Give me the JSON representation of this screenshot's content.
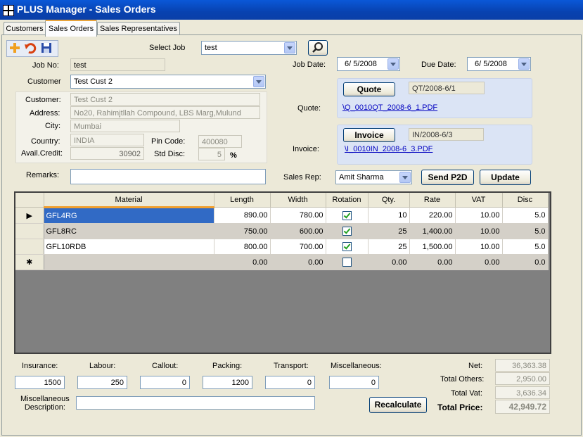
{
  "window": {
    "title": "PLUS Manager - Sales Orders"
  },
  "tabs": [
    {
      "label": "Customers"
    },
    {
      "label": "Sales Orders"
    },
    {
      "label": "Sales Representatives"
    }
  ],
  "toolbar": {
    "add_icon": "add-icon",
    "undo_icon": "undo-icon",
    "save_icon": "save-icon"
  },
  "select_job": {
    "label": "Select Job",
    "value": "test",
    "search_icon": "search-icon"
  },
  "job": {
    "job_no_label": "Job No:",
    "job_no": "test",
    "job_date_label": "Job Date:",
    "job_date": "6/ 5/2008",
    "due_date_label": "Due Date:",
    "due_date": "6/ 5/2008"
  },
  "customer": {
    "label": "Customer",
    "value": "Test Cust 2",
    "name_label": "Customer:",
    "name": "Test Cust 2",
    "address_label": "Address:",
    "address": "No20, Rahimjtllah Compound, LBS Marg,Mulund",
    "city_label": "City:",
    "city": "Mumbai",
    "country_label": "Country:",
    "country": "INDIA",
    "pin_label": "Pin Code:",
    "pin": "400080",
    "credit_label": "Avail.Credit:",
    "credit": "30902",
    "disc_label": "Std Disc:",
    "disc": "5",
    "disc_unit": "%"
  },
  "quote": {
    "button": "Quote",
    "number": "QT/2008-6/1",
    "label": "Quote:",
    "link": "\\Q_0010QT_2008-6_1.PDF"
  },
  "invoice": {
    "button": "Invoice",
    "number": "IN/2008-6/3",
    "label": "Invoice:",
    "link": "\\I_0010IN_2008-6_3.PDF"
  },
  "remarks": {
    "label": "Remarks:",
    "value": ""
  },
  "sales_rep": {
    "label": "Sales Rep:",
    "value": "Amit Sharma"
  },
  "buttons": {
    "send_p2d": "Send P2D",
    "update": "Update",
    "recalculate": "Recalculate"
  },
  "grid": {
    "columns": [
      "Material",
      "Length",
      "Width",
      "Rotation",
      "Qty.",
      "Rate",
      "VAT",
      "Disc"
    ],
    "rows": [
      {
        "marker": "▶",
        "material": "GFL4RG",
        "length": "890.00",
        "width": "780.00",
        "rotation": true,
        "qty": "10",
        "rate": "220.00",
        "vat": "10.00",
        "disc": "5.0"
      },
      {
        "marker": "",
        "material": "GFL8RC",
        "length": "750.00",
        "width": "600.00",
        "rotation": true,
        "qty": "25",
        "rate": "1,400.00",
        "vat": "10.00",
        "disc": "5.0"
      },
      {
        "marker": "",
        "material": "GFL10RDB",
        "length": "800.00",
        "width": "700.00",
        "rotation": true,
        "qty": "25",
        "rate": "1,500.00",
        "vat": "10.00",
        "disc": "5.0"
      },
      {
        "marker": "✱",
        "material": "",
        "length": "0.00",
        "width": "0.00",
        "rotation": false,
        "qty": "0.00",
        "rate": "0.00",
        "vat": "0.00",
        "disc": "0.0"
      }
    ]
  },
  "charges": {
    "insurance_label": "Insurance:",
    "insurance": "1500",
    "labour_label": "Labour:",
    "labour": "250",
    "callout_label": "Callout:",
    "callout": "0",
    "packing_label": "Packing:",
    "packing": "1200",
    "transport_label": "Transport:",
    "transport": "0",
    "misc_label": "Miscellaneous:",
    "misc": "0",
    "misc_desc_label_1": "Miscellaneous",
    "misc_desc_label_2": "Description:",
    "misc_desc": ""
  },
  "totals": {
    "net_label": "Net:",
    "net": "36,363.38",
    "others_label": "Total Others:",
    "others": "2,950.00",
    "vat_label": "Total Vat:",
    "vat": "3,636.34",
    "price_label": "Total Price:",
    "price": "42,949.72"
  }
}
